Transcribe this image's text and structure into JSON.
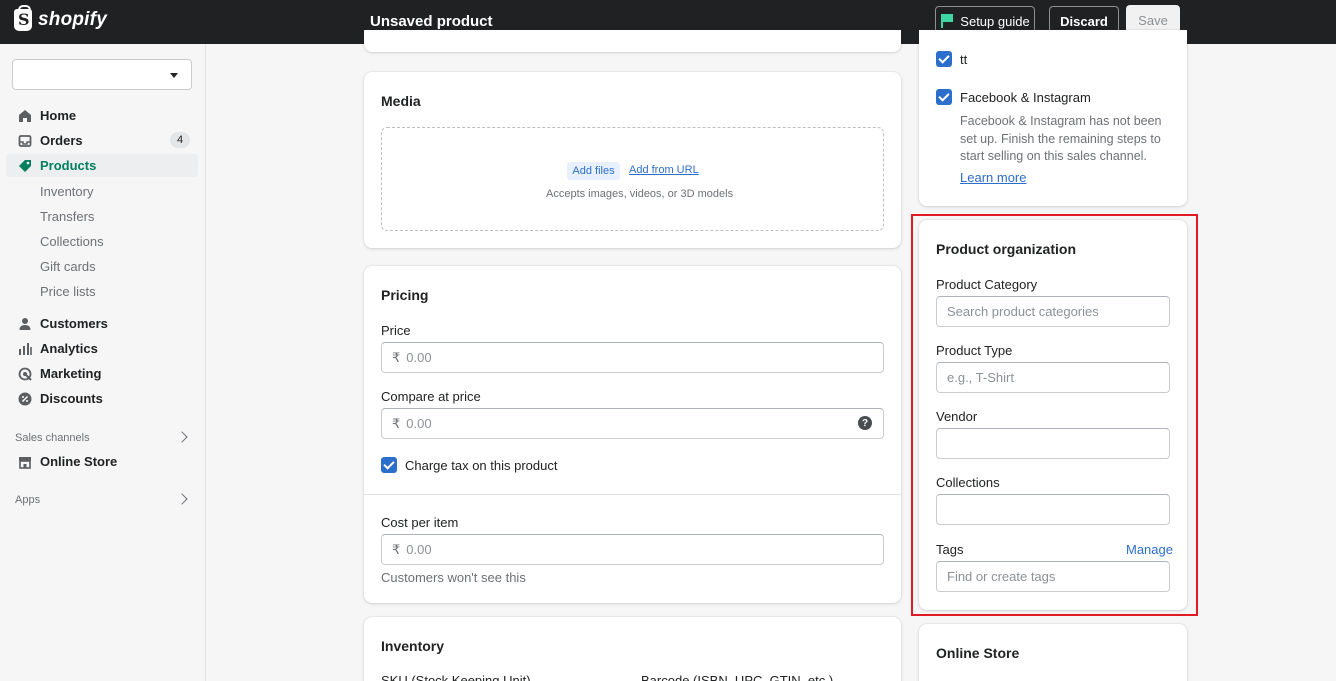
{
  "topbar": {
    "logo_text": "shopify",
    "page_title": "Unsaved product",
    "setup_guide_label": "Setup guide",
    "discard_label": "Discard",
    "save_label": "Save"
  },
  "sidebar": {
    "items": [
      {
        "label": "Home",
        "icon": "home-icon"
      },
      {
        "label": "Orders",
        "icon": "orders-icon",
        "badge": "4"
      },
      {
        "label": "Products",
        "icon": "tag-icon",
        "active": true
      },
      {
        "label": "Customers",
        "icon": "person-icon"
      },
      {
        "label": "Analytics",
        "icon": "bar-chart-icon"
      },
      {
        "label": "Marketing",
        "icon": "marketing-icon"
      },
      {
        "label": "Discounts",
        "icon": "discount-icon"
      }
    ],
    "product_sub_items": [
      "Inventory",
      "Transfers",
      "Collections",
      "Gift cards",
      "Price lists"
    ],
    "sales_channels_label": "Sales channels",
    "online_store_label": "Online Store",
    "apps_label": "Apps"
  },
  "media": {
    "title": "Media",
    "add_files_label": "Add files",
    "add_from_url_label": "Add from URL",
    "hint": "Accepts images, videos, or 3D models"
  },
  "pricing": {
    "title": "Pricing",
    "price_label": "Price",
    "price_value": "0.00",
    "compare_label": "Compare at price",
    "compare_value": "0.00",
    "currency": "₹",
    "charge_tax_label": "Charge tax on this product",
    "cost_label": "Cost per item",
    "cost_value": "0.00",
    "cost_hint": "Customers won't see this"
  },
  "inventory": {
    "title": "Inventory",
    "sku_label": "SKU (Stock Keeping Unit)",
    "barcode_label": "Barcode (ISBN, UPC, GTIN, etc.)"
  },
  "sales_channels": {
    "channel_1": "tt",
    "channel_2": "Facebook & Instagram",
    "channel_2_note_l1": "Facebook & Instagram has not been",
    "channel_2_note_l2": "set up. Finish the remaining steps to",
    "channel_2_note_l3": "start selling on this sales channel.",
    "learn_more": "Learn more"
  },
  "product_org": {
    "title": "Product organization",
    "category_label": "Product Category",
    "category_placeholder": "Search product categories",
    "type_label": "Product Type",
    "type_placeholder": "e.g., T-Shirt",
    "vendor_label": "Vendor",
    "collections_label": "Collections",
    "tags_label": "Tags",
    "manage_label": "Manage",
    "tags_placeholder": "Find or create tags"
  },
  "online_store_card": {
    "title": "Online Store"
  },
  "colors": {
    "accent_green": "#007f5f",
    "link_blue": "#2c6ecb",
    "highlight_red": "#e01b24"
  }
}
